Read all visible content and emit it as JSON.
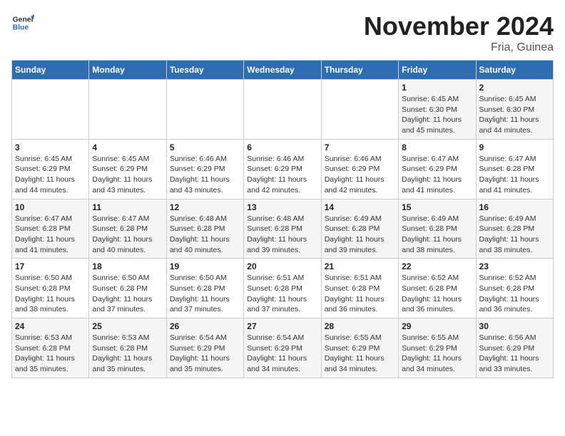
{
  "header": {
    "logo_general": "General",
    "logo_blue": "Blue",
    "month_title": "November 2024",
    "location": "Fria, Guinea"
  },
  "weekdays": [
    "Sunday",
    "Monday",
    "Tuesday",
    "Wednesday",
    "Thursday",
    "Friday",
    "Saturday"
  ],
  "weeks": [
    [
      {
        "day": "",
        "info": ""
      },
      {
        "day": "",
        "info": ""
      },
      {
        "day": "",
        "info": ""
      },
      {
        "day": "",
        "info": ""
      },
      {
        "day": "",
        "info": ""
      },
      {
        "day": "1",
        "info": "Sunrise: 6:45 AM\nSunset: 6:30 PM\nDaylight: 11 hours and 45 minutes."
      },
      {
        "day": "2",
        "info": "Sunrise: 6:45 AM\nSunset: 6:30 PM\nDaylight: 11 hours and 44 minutes."
      }
    ],
    [
      {
        "day": "3",
        "info": "Sunrise: 6:45 AM\nSunset: 6:29 PM\nDaylight: 11 hours and 44 minutes."
      },
      {
        "day": "4",
        "info": "Sunrise: 6:45 AM\nSunset: 6:29 PM\nDaylight: 11 hours and 43 minutes."
      },
      {
        "day": "5",
        "info": "Sunrise: 6:46 AM\nSunset: 6:29 PM\nDaylight: 11 hours and 43 minutes."
      },
      {
        "day": "6",
        "info": "Sunrise: 6:46 AM\nSunset: 6:29 PM\nDaylight: 11 hours and 42 minutes."
      },
      {
        "day": "7",
        "info": "Sunrise: 6:46 AM\nSunset: 6:29 PM\nDaylight: 11 hours and 42 minutes."
      },
      {
        "day": "8",
        "info": "Sunrise: 6:47 AM\nSunset: 6:29 PM\nDaylight: 11 hours and 41 minutes."
      },
      {
        "day": "9",
        "info": "Sunrise: 6:47 AM\nSunset: 6:28 PM\nDaylight: 11 hours and 41 minutes."
      }
    ],
    [
      {
        "day": "10",
        "info": "Sunrise: 6:47 AM\nSunset: 6:28 PM\nDaylight: 11 hours and 41 minutes."
      },
      {
        "day": "11",
        "info": "Sunrise: 6:47 AM\nSunset: 6:28 PM\nDaylight: 11 hours and 40 minutes."
      },
      {
        "day": "12",
        "info": "Sunrise: 6:48 AM\nSunset: 6:28 PM\nDaylight: 11 hours and 40 minutes."
      },
      {
        "day": "13",
        "info": "Sunrise: 6:48 AM\nSunset: 6:28 PM\nDaylight: 11 hours and 39 minutes."
      },
      {
        "day": "14",
        "info": "Sunrise: 6:49 AM\nSunset: 6:28 PM\nDaylight: 11 hours and 39 minutes."
      },
      {
        "day": "15",
        "info": "Sunrise: 6:49 AM\nSunset: 6:28 PM\nDaylight: 11 hours and 38 minutes."
      },
      {
        "day": "16",
        "info": "Sunrise: 6:49 AM\nSunset: 6:28 PM\nDaylight: 11 hours and 38 minutes."
      }
    ],
    [
      {
        "day": "17",
        "info": "Sunrise: 6:50 AM\nSunset: 6:28 PM\nDaylight: 11 hours and 38 minutes."
      },
      {
        "day": "18",
        "info": "Sunrise: 6:50 AM\nSunset: 6:28 PM\nDaylight: 11 hours and 37 minutes."
      },
      {
        "day": "19",
        "info": "Sunrise: 6:50 AM\nSunset: 6:28 PM\nDaylight: 11 hours and 37 minutes."
      },
      {
        "day": "20",
        "info": "Sunrise: 6:51 AM\nSunset: 6:28 PM\nDaylight: 11 hours and 37 minutes."
      },
      {
        "day": "21",
        "info": "Sunrise: 6:51 AM\nSunset: 6:28 PM\nDaylight: 11 hours and 36 minutes."
      },
      {
        "day": "22",
        "info": "Sunrise: 6:52 AM\nSunset: 6:28 PM\nDaylight: 11 hours and 36 minutes."
      },
      {
        "day": "23",
        "info": "Sunrise: 6:52 AM\nSunset: 6:28 PM\nDaylight: 11 hours and 36 minutes."
      }
    ],
    [
      {
        "day": "24",
        "info": "Sunrise: 6:53 AM\nSunset: 6:28 PM\nDaylight: 11 hours and 35 minutes."
      },
      {
        "day": "25",
        "info": "Sunrise: 6:53 AM\nSunset: 6:28 PM\nDaylight: 11 hours and 35 minutes."
      },
      {
        "day": "26",
        "info": "Sunrise: 6:54 AM\nSunset: 6:29 PM\nDaylight: 11 hours and 35 minutes."
      },
      {
        "day": "27",
        "info": "Sunrise: 6:54 AM\nSunset: 6:29 PM\nDaylight: 11 hours and 34 minutes."
      },
      {
        "day": "28",
        "info": "Sunrise: 6:55 AM\nSunset: 6:29 PM\nDaylight: 11 hours and 34 minutes."
      },
      {
        "day": "29",
        "info": "Sunrise: 6:55 AM\nSunset: 6:29 PM\nDaylight: 11 hours and 34 minutes."
      },
      {
        "day": "30",
        "info": "Sunrise: 6:56 AM\nSunset: 6:29 PM\nDaylight: 11 hours and 33 minutes."
      }
    ]
  ]
}
